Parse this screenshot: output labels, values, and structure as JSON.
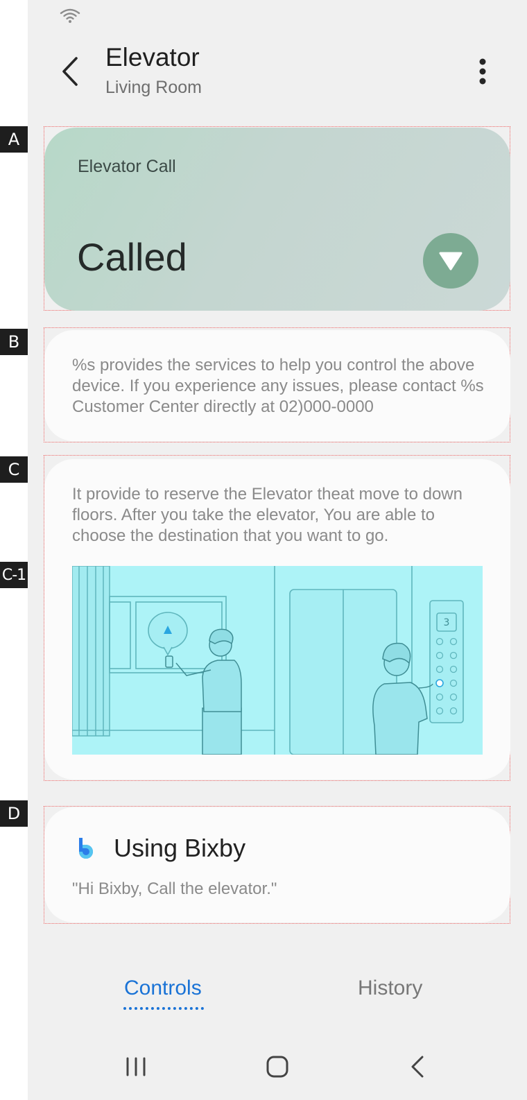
{
  "header": {
    "title": "Elevator",
    "subtitle": "Living Room"
  },
  "markers": {
    "a": "A",
    "b": "B",
    "c": "C",
    "c1": "C-1",
    "d": "D"
  },
  "elevator_call": {
    "label": "Elevator Call",
    "status": "Called",
    "button_color": "#7dab93"
  },
  "notice": {
    "text": "%s provides the services to help you control the above device. If you experience any issues, please contact %s Customer Center directly at 02)000-0000"
  },
  "description": {
    "text": "It provide to reserve the Elevator theat move to down floors. After you take the elevator, You are able to choose the destination that you want to go.",
    "floor_display": "3"
  },
  "bixby": {
    "title": "Using Bixby",
    "quote": "\"Hi Bixby, Call the elevator.\""
  },
  "tabs": {
    "controls": "Controls",
    "history": "History",
    "active": "Controls",
    "accent_color": "#1a73d6"
  },
  "icons": {
    "status": "wifi-icon",
    "back": "back-arrow-icon",
    "more": "more-vertical-icon",
    "call": "triangle-down-icon",
    "bixby": "bixby-logo-icon",
    "nav_recent": "recent-apps-icon",
    "nav_home": "home-icon",
    "nav_back": "back-icon"
  }
}
